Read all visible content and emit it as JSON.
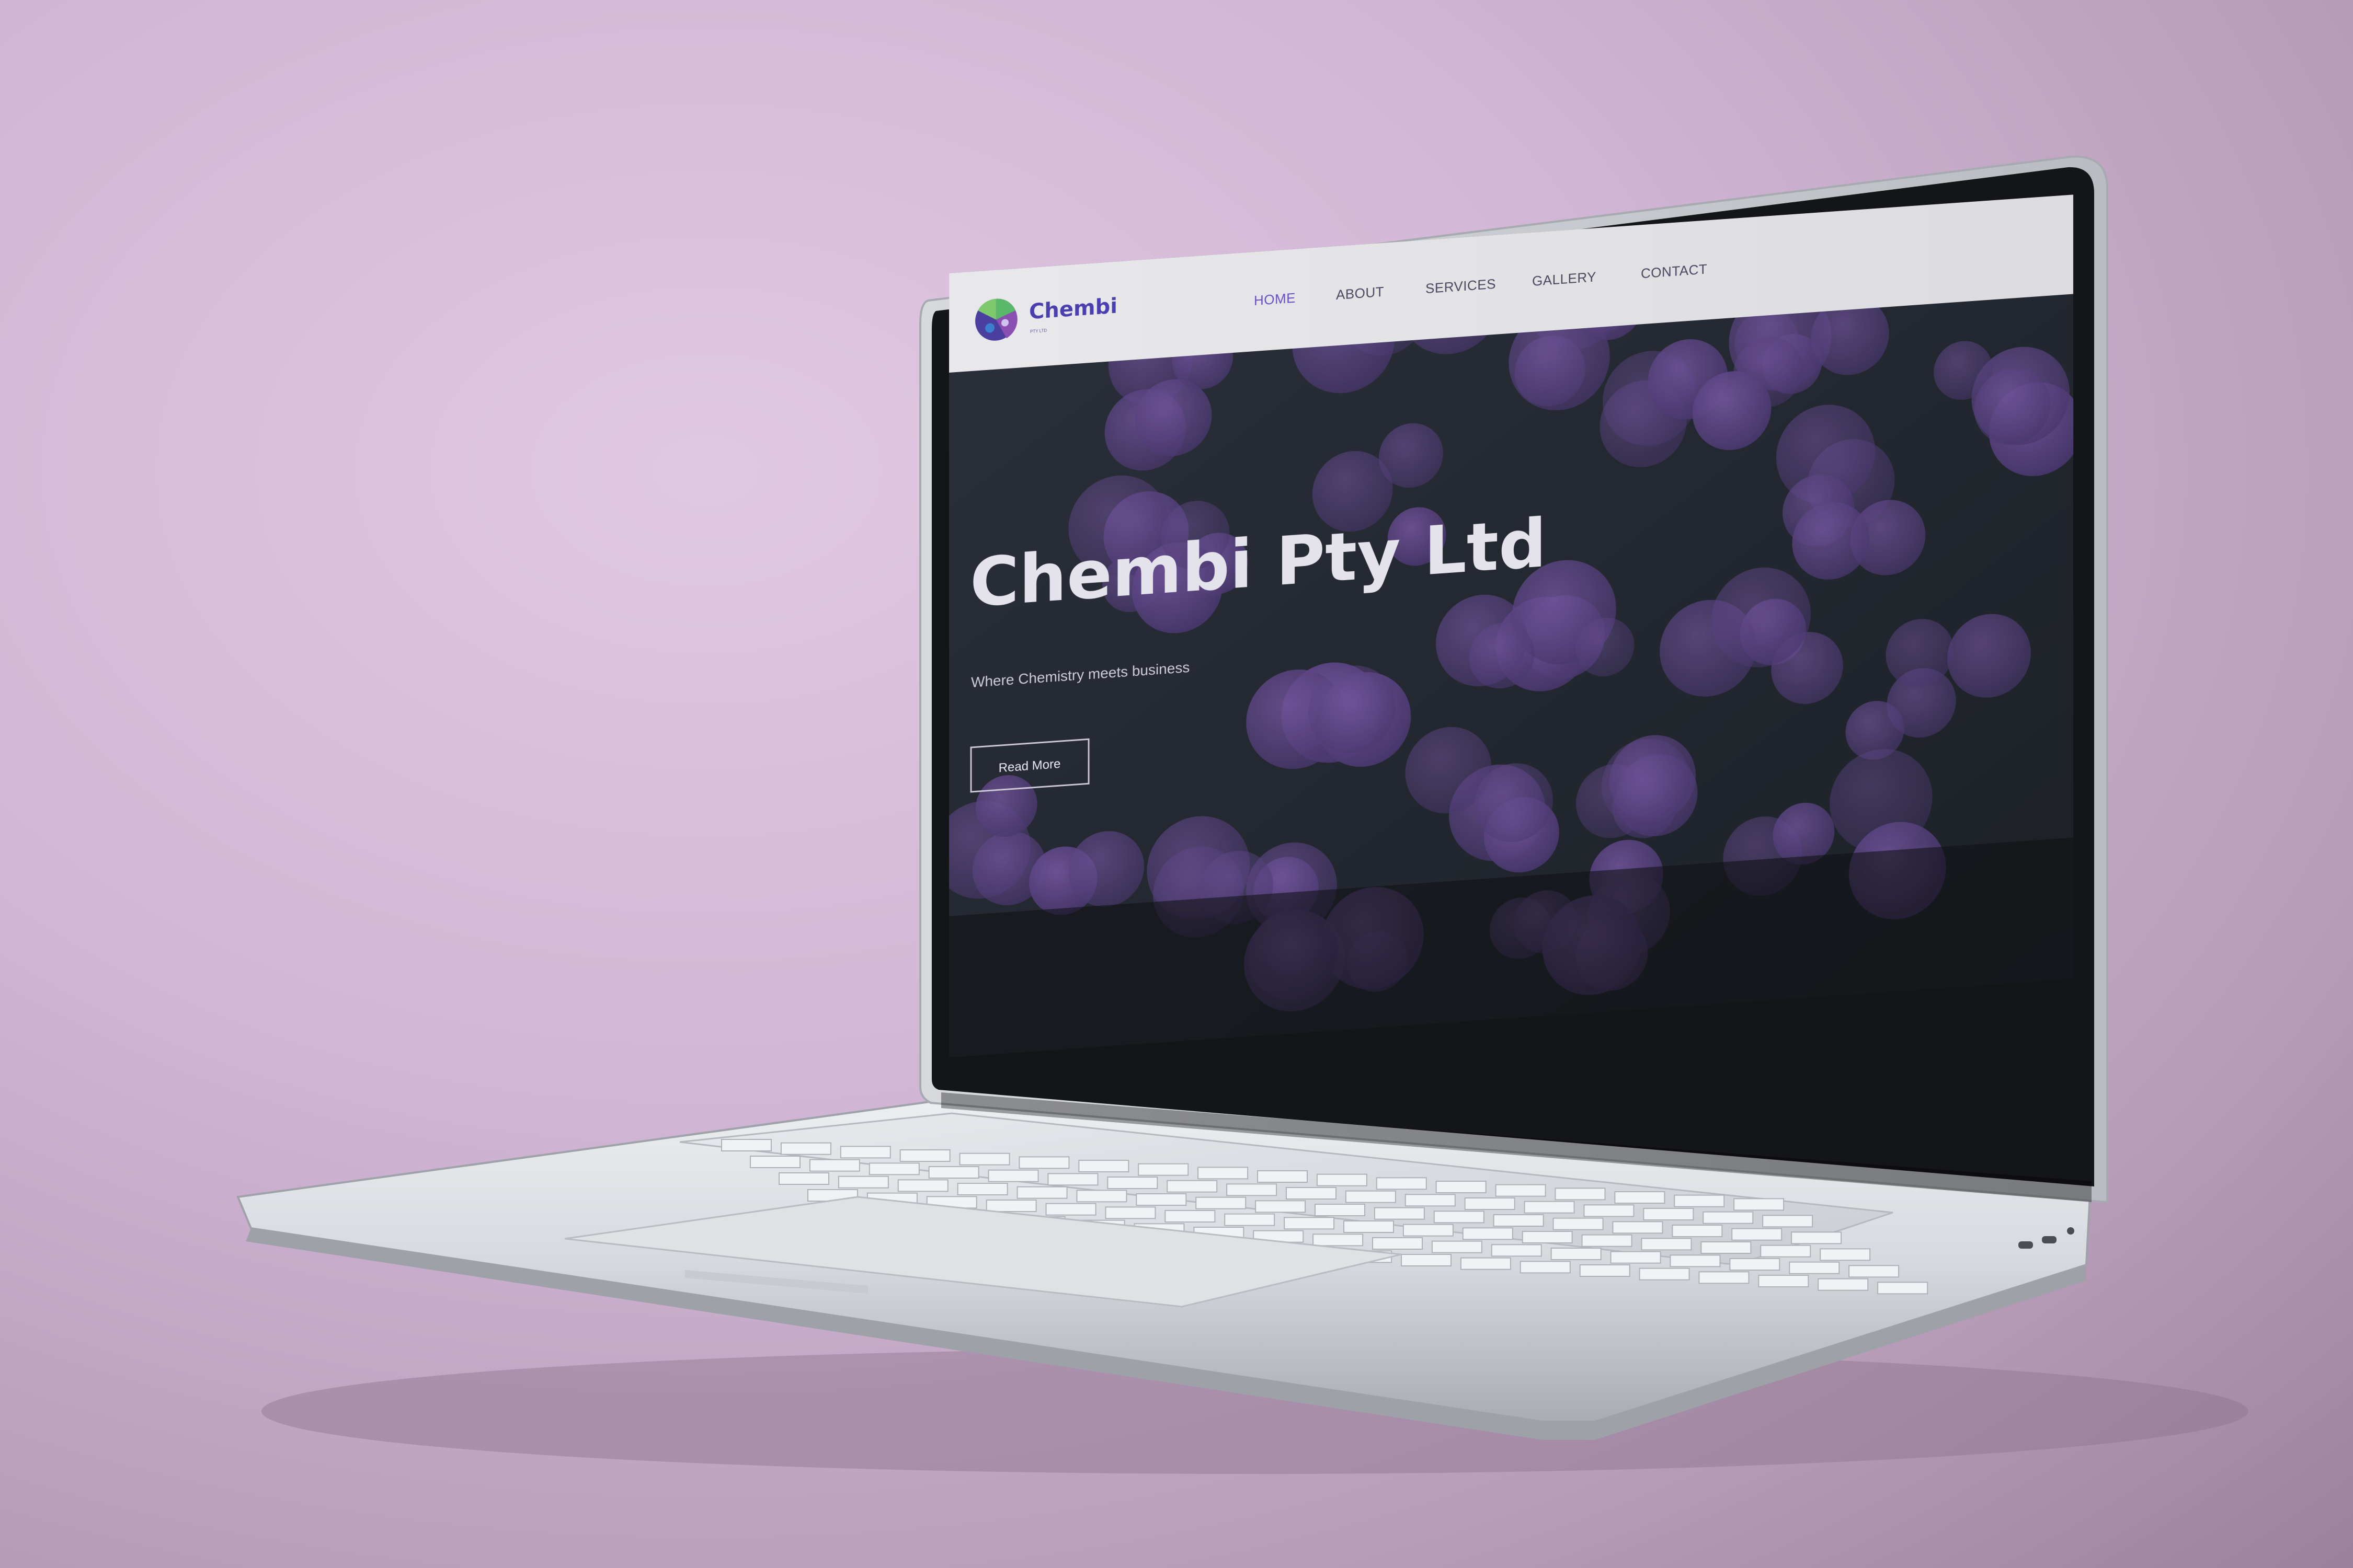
{
  "site": {
    "brand": "Chembi",
    "brand_tagline": "PTY LTD"
  },
  "nav": {
    "items": [
      {
        "label": "HOME",
        "active": true
      },
      {
        "label": "ABOUT",
        "active": false
      },
      {
        "label": "SERVICES",
        "active": false
      },
      {
        "label": "GALLERY",
        "active": false
      },
      {
        "label": "CONTACT",
        "active": false
      }
    ]
  },
  "hero": {
    "title": "Chembi Pty Ltd",
    "subtitle": "Where Chemistry meets business",
    "button_label": "Read More"
  },
  "colors": {
    "accent": "#6a4fc8",
    "hero_bg": "#23272f",
    "bubble": "#5a4585",
    "page_bg": "#d2b6d6"
  },
  "icons": {
    "logo": "molecule-logo-icon",
    "camera": "webcam-icon"
  }
}
